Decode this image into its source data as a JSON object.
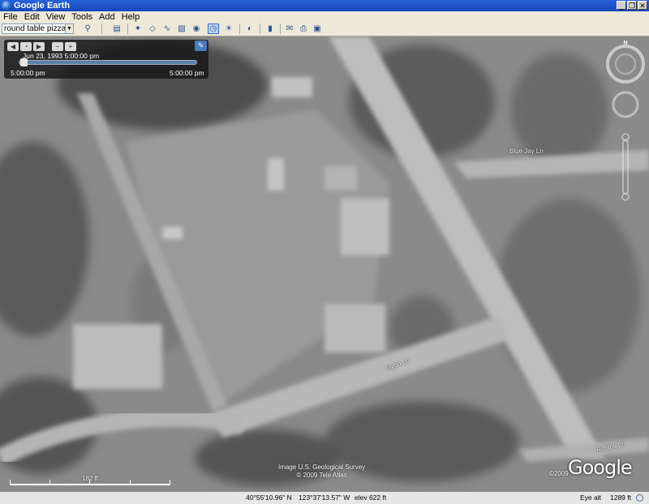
{
  "window": {
    "title": "Google Earth",
    "controls": [
      "_",
      "❒",
      "✕"
    ]
  },
  "menu": [
    "File",
    "Edit",
    "View",
    "Tools",
    "Add",
    "Help"
  ],
  "search": {
    "value": "round table pizza"
  },
  "time_slider": {
    "current_date": "Jun 23, 1993   5:00:00 pm",
    "start_label": "5:00:00 pm",
    "end_label": "5:00:00 pm"
  },
  "navigation": {
    "north_label": "N"
  },
  "road_labels": {
    "blue_jay": "Blue Jay Ln",
    "gypo": "Gypo Ln",
    "robins": "Robins Ln"
  },
  "scale": {
    "label": "182 ft"
  },
  "attribution": {
    "line1": "Image U.S. Geological Survey",
    "line2": "© 2009 Tele Atlas",
    "copyright": "©2009",
    "logo": "Google"
  },
  "status": {
    "lat": "40°55'10.96\" N",
    "lon": "123°37'13.57\" W",
    "elev": "elev  622 ft",
    "eye_label": "Eye alt",
    "eye_value": "1289 ft"
  }
}
